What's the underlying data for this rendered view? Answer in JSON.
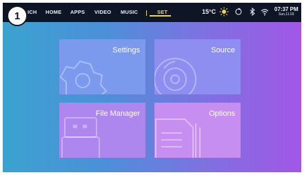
{
  "badge": {
    "number": "1"
  },
  "nav": {
    "items": [
      {
        "label": "ICH",
        "active": false
      },
      {
        "label": "HOME",
        "active": false
      },
      {
        "label": "APPS",
        "active": false
      },
      {
        "label": "VIDEO",
        "active": false
      },
      {
        "label": "MUSIC",
        "active": false
      },
      {
        "label": "SET",
        "active": true
      }
    ]
  },
  "status": {
    "temperature": "15°C",
    "weather_icon": "sun-icon",
    "time": "07:37 PM",
    "date": "Sun,11.03"
  },
  "tiles": [
    {
      "label": "Settings",
      "icon": "gear-icon"
    },
    {
      "label": "Source",
      "icon": "disc-icon"
    },
    {
      "label": "File Manager",
      "icon": "usb-drive-icon"
    },
    {
      "label": "Options",
      "icon": "document-icon"
    }
  ],
  "colors": {
    "accent": "#f5d34a",
    "topbar": "#0e1626",
    "gradient_start": "#3aa3cf",
    "gradient_end": "#a257e6"
  }
}
